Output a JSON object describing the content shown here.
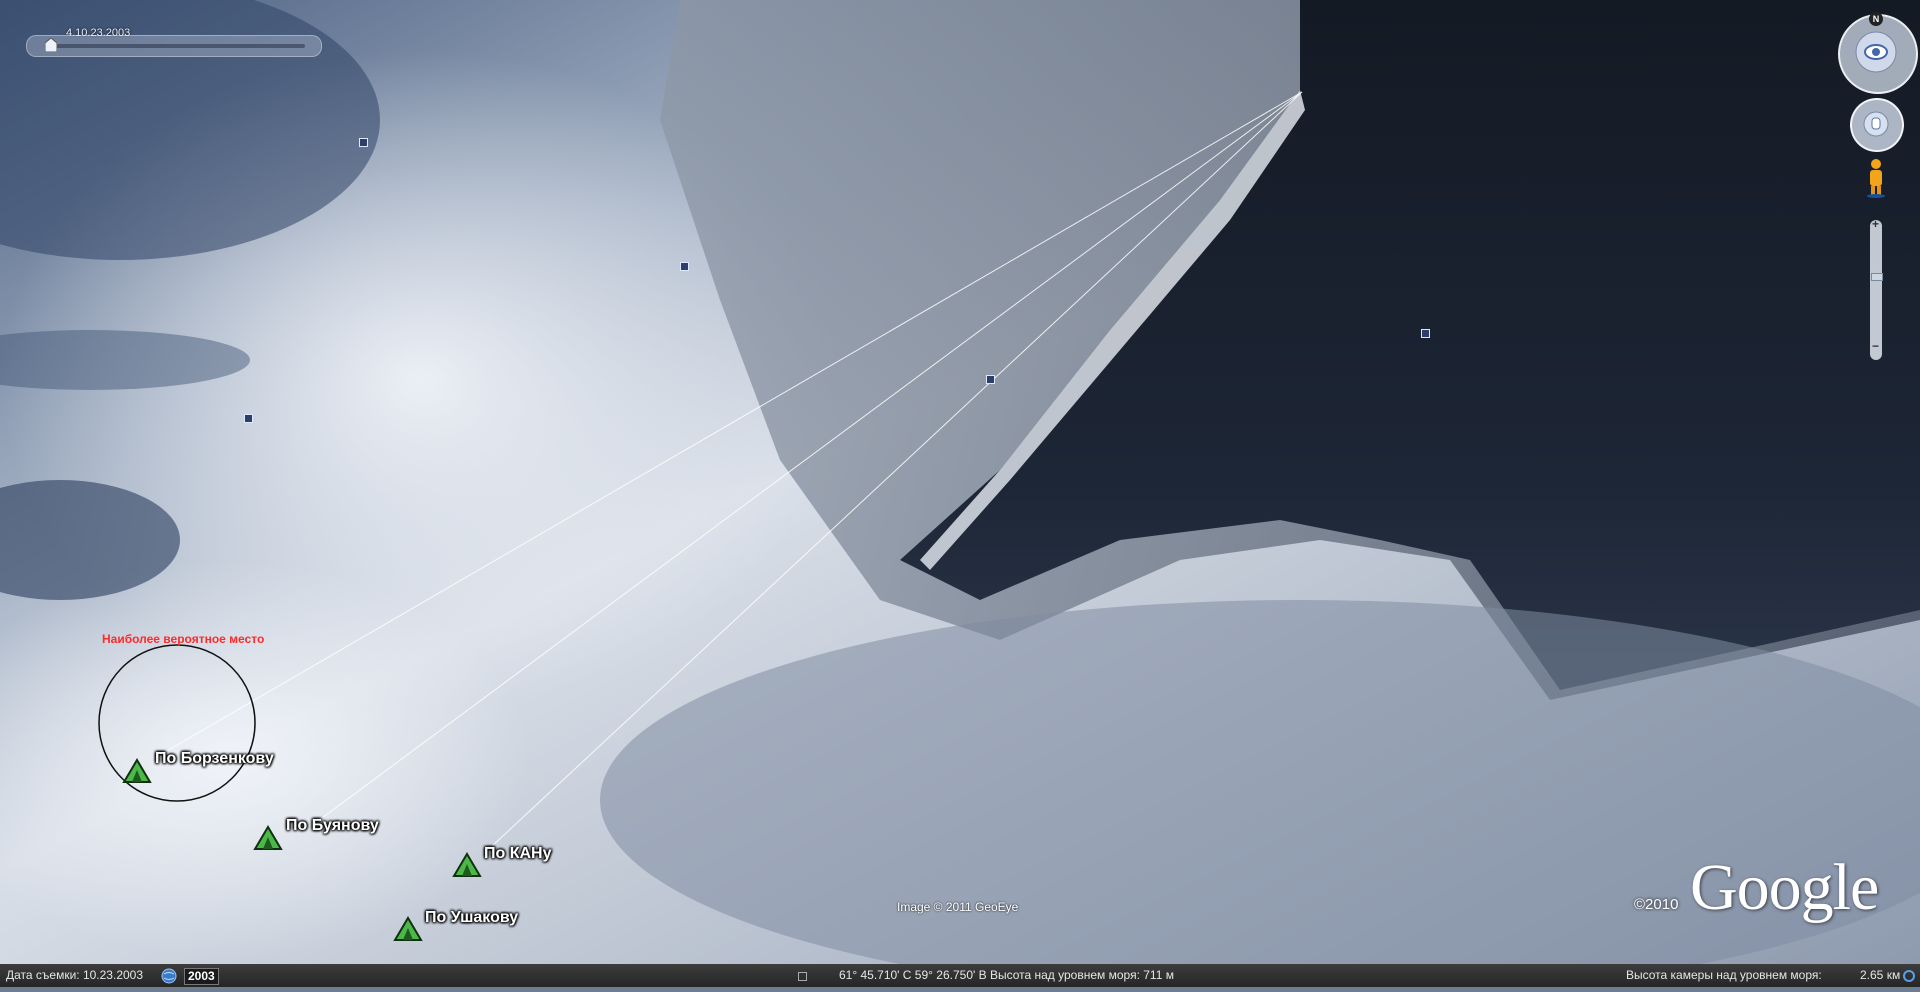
{
  "time_slider": {
    "date": "4.10.23.2003"
  },
  "annotations": {
    "note": "Наиболее вероятное место",
    "markers": [
      {
        "label": "По Борзенкову"
      },
      {
        "label": "По Буянову"
      },
      {
        "label": "По КАНу"
      },
      {
        "label": "По Ушакову"
      }
    ]
  },
  "navigation": {
    "north_label": "N"
  },
  "branding": {
    "year": "©2010",
    "logo": "Google",
    "imagery": "Image © 2011 GeoEye"
  },
  "status_bar": {
    "capture_date": "Дата съемки: 10.23.2003",
    "year_badge": "2003",
    "coordinates": "61° 45.710' С  59° 26.750' В  Высота над уровнем моря:  711 м",
    "camera_altitude": "Высота камеры над уровнем моря:",
    "camera_value": "2.65 км"
  },
  "colors": {
    "tent_fill": "#4cb84a",
    "note_red": "#ff2a2a",
    "status_bg": "#2e2e2e"
  }
}
